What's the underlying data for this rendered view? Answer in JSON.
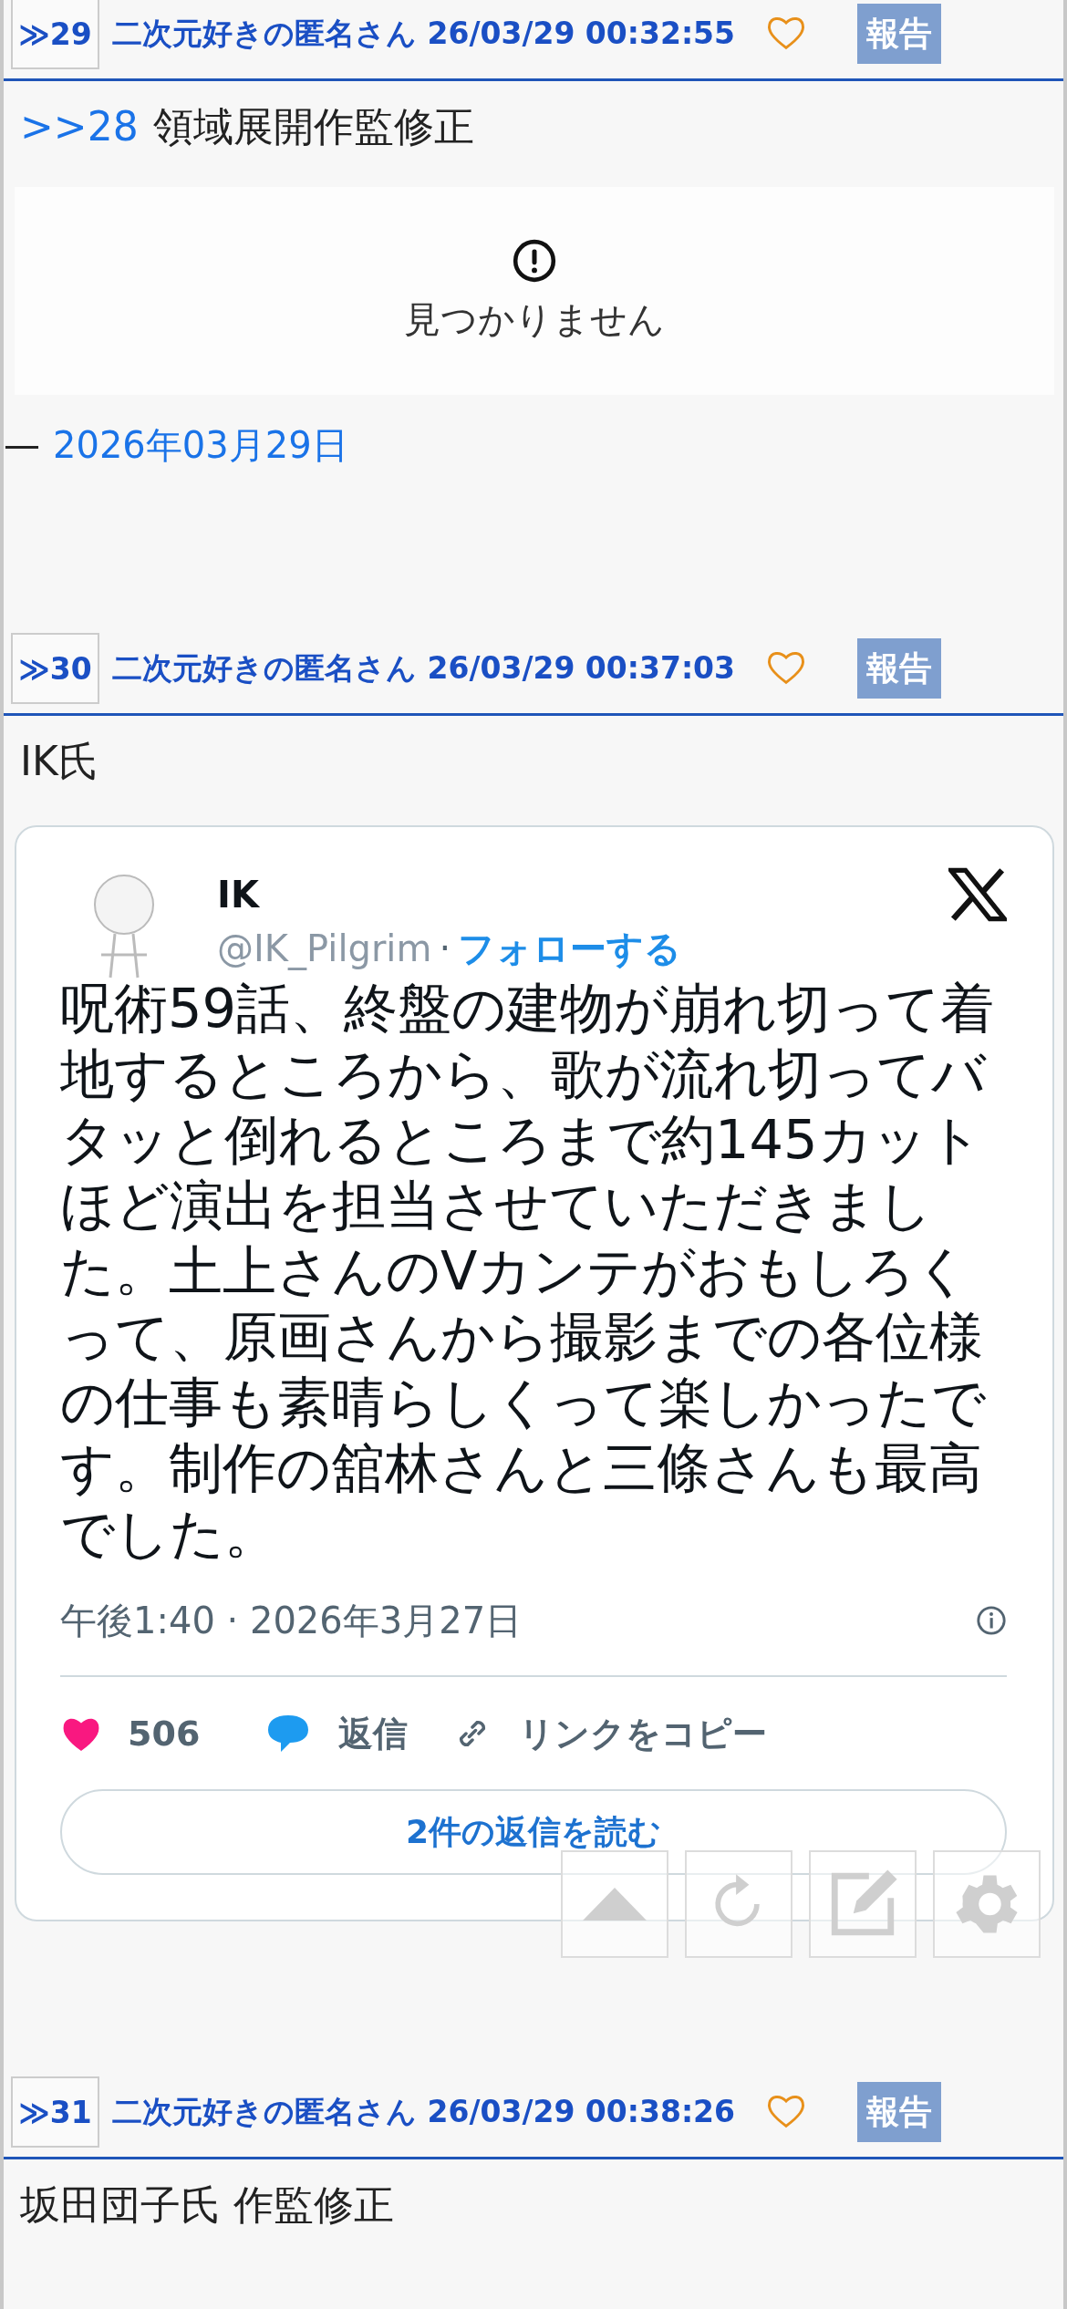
{
  "posts": [
    {
      "number": "≫29",
      "author_line": "二次元好きの匿名さん 26/03/29 00:32:55",
      "liked": false,
      "report": "報告",
      "body": [
        {
          "kind": "reply",
          "anchor": ">>28",
          "text": "領域展開作監修正"
        },
        {
          "kind": "missing_embed",
          "message": "見つかりません"
        },
        {
          "kind": "date_line",
          "dash": "—",
          "date": "2026年03月29日"
        }
      ]
    },
    {
      "number": "≫30",
      "author_line": "二次元好きの匿名さん 26/03/29 00:37:03",
      "liked": false,
      "report": "報告",
      "body": [
        {
          "kind": "text",
          "text": "IK氏"
        },
        {
          "kind": "tweet",
          "name": "IK",
          "handle": "@IK_Pilgrim",
          "separator": "·",
          "follow": "フォローする",
          "text": "呪術59話、終盤の建物が崩れ切って着地するところから、歌が流れ切ってバタッと倒れるところまで約145カットほど演出を担当させていただきました。土上さんのVカンテがおもしろくって、原画さんから撮影までの各位様の仕事も素晴らしくって楽しかったです。制作の舘林さんと三條さんも最高でした。",
          "time": "午後1:40 · 2026年3月27日",
          "likes": "506",
          "reply": "返信",
          "copy_link": "リンクをコピー",
          "read_replies": "2件の返信を読む"
        }
      ]
    },
    {
      "number": "≫31",
      "author_line": "二次元好きの匿名さん 26/03/29 00:38:26",
      "liked": false,
      "report": "報告",
      "body": [
        {
          "kind": "text",
          "text": "坂田団子氏 作監修正"
        }
      ]
    }
  ]
}
